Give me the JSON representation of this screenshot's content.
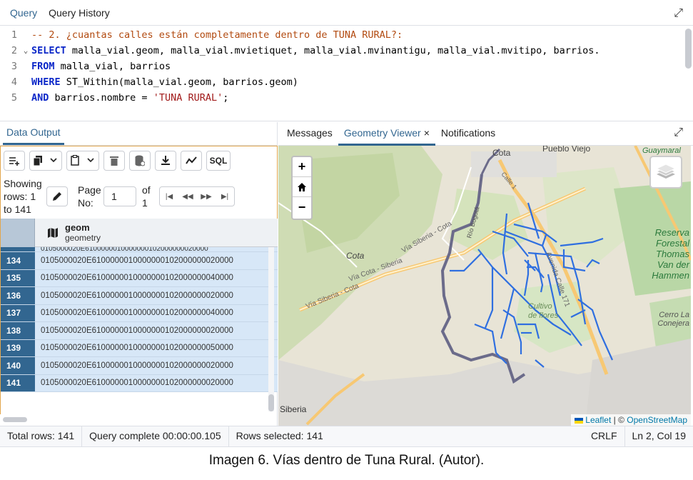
{
  "editor": {
    "tabs": [
      "Query",
      "Query History"
    ],
    "lines": [
      {
        "num": "1",
        "parts": [
          {
            "t": "cm",
            "v": "-- 2. ¿cuantas calles están completamente dentro de TUNA RURAL?:"
          }
        ]
      },
      {
        "num": "2",
        "fold": "⌄",
        "parts": [
          {
            "t": "kw",
            "v": "SELECT"
          },
          {
            "t": "ct",
            "v": " malla_vial.geom, malla_vial.mvietiquet, malla_vial.mvinantigu, malla_vial.mvitipo, barrios."
          }
        ]
      },
      {
        "num": "3",
        "parts": [
          {
            "t": "kw",
            "v": "FROM"
          },
          {
            "t": "ct",
            "v": " malla_vial, barrios"
          }
        ]
      },
      {
        "num": "4",
        "parts": [
          {
            "t": "kw",
            "v": "WHERE"
          },
          {
            "t": "ct",
            "v": " ST_Within(malla_vial.geom, barrios.geom)"
          }
        ]
      },
      {
        "num": "5",
        "parts": [
          {
            "t": "kw",
            "v": "AND"
          },
          {
            "t": "ct",
            "v": " barrios.nombre = "
          },
          {
            "t": "st",
            "v": "'TUNA RURAL'"
          },
          {
            "t": "ct",
            "v": ";"
          }
        ]
      }
    ]
  },
  "data_output": {
    "tab": "Data Output",
    "showing": "Showing rows: 1 to 141",
    "page_label": "Page No:",
    "page_value": "1",
    "of_label": "of 1",
    "sql_label": "SQL",
    "column": {
      "name": "geom",
      "type": "geometry"
    },
    "partial_row": "0105000020E6100000010000000102000000020000",
    "rows": [
      {
        "num": "134",
        "value": "0105000020E6100000010000000102000000020000"
      },
      {
        "num": "135",
        "value": "0105000020E6100000010000000102000000040000"
      },
      {
        "num": "136",
        "value": "0105000020E6100000010000000102000000020000"
      },
      {
        "num": "137",
        "value": "0105000020E6100000010000000102000000040000"
      },
      {
        "num": "138",
        "value": "0105000020E6100000010000000102000000020000"
      },
      {
        "num": "139",
        "value": "0105000020E6100000010000000102000000050000"
      },
      {
        "num": "140",
        "value": "0105000020E6100000010000000102000000020000"
      },
      {
        "num": "141",
        "value": "0105000020E6100000010000000102000000020000"
      }
    ]
  },
  "right_tabs": {
    "messages": "Messages",
    "geometry_viewer": "Geometry Viewer",
    "close_glyph": "×",
    "notifications": "Notifications"
  },
  "map": {
    "labels": {
      "cota": "Cota",
      "pueblo_viejo": "Pueblo Viejo",
      "guaymaral": "Guaymaral",
      "cota2": "Cota",
      "via_siberia_cota": "Vía Siberia - Cota",
      "via_cota_siberia": "Vía Cota - Siberia",
      "reserva": "Reserva Forestal Thomas Van der Hammen",
      "cultivo": "Cultivo de flores",
      "cerro": "Cerro La Conejera",
      "siberia": "Siberia",
      "rio_bogota": "Río Bogotá",
      "avenida": "Avenida Calle 171",
      "calle": "Calle 1"
    },
    "attribution_leaflet": "Leaflet",
    "attribution_sep": " | © ",
    "attribution_osm": "OpenStreetMap",
    "colors": {
      "roads": "#2f6fe0",
      "river": "#6b6b8a"
    }
  },
  "status": {
    "total_rows": "Total rows: 141",
    "query_complete": "Query complete 00:00:00.105",
    "rows_selected": "Rows selected: 141",
    "eol": "CRLF",
    "position": "Ln 2, Col 19"
  },
  "caption": "Imagen 6. Vías dentro de Tuna Rural. (Autor)."
}
